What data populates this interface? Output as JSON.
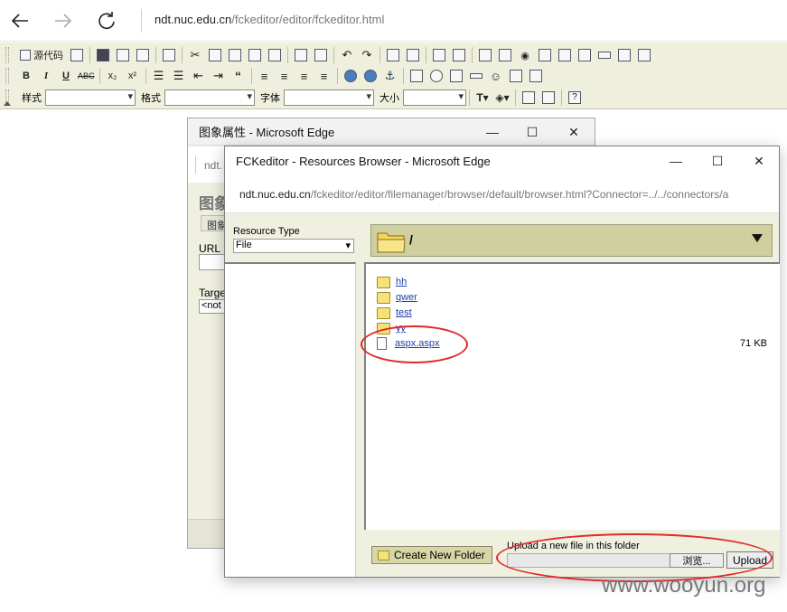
{
  "browser": {
    "address_host": "ndt.nuc.edu.cn",
    "address_path": "/fckeditor/editor/fckeditor.html"
  },
  "toolbar": {
    "source_label": "源代码",
    "style_label": "样式",
    "format_label": "格式",
    "font_label": "字体",
    "size_label": "大小",
    "bold": "B",
    "italic": "I",
    "underline": "U",
    "strike": "ABC",
    "subscript": "x₂",
    "superscript": "x²"
  },
  "image_window": {
    "title": "图象属性 - Microsoft Edge",
    "address": "ndt.",
    "heading": "图象",
    "tab": "图象",
    "url_label": "URL",
    "target_label": "Targe",
    "target_value": "<not"
  },
  "browser_window": {
    "title": "FCKeditor - Resources Browser - Microsoft Edge",
    "address_host": "ndt.nuc.edu.cn",
    "address_path": "/fckeditor/editor/filemanager/browser/default/browser.html?Connector=../../connectors/a",
    "resource_type_label": "Resource Type",
    "resource_type_value": "File",
    "current_folder": "/",
    "items": [
      {
        "name": "hh",
        "type": "folder",
        "size": ""
      },
      {
        "name": "qwer",
        "type": "folder",
        "size": ""
      },
      {
        "name": "test",
        "type": "folder",
        "size": ""
      },
      {
        "name": "yy",
        "type": "folder",
        "size": ""
      },
      {
        "name": "aspx.aspx",
        "type": "file",
        "size": "71 KB"
      }
    ],
    "new_folder_label": "Create New Folder",
    "upload_label": "Upload a new file in this folder",
    "browse_label": "浏览...",
    "upload_button": "Upload"
  },
  "watermark": "www.wooyun.org",
  "colors": {
    "toolbar_bg": "#efefde",
    "folder_bar_bg": "#cfcf9f",
    "link_blue": "#1e3ea8",
    "annotation_red": "#e02a2a"
  }
}
